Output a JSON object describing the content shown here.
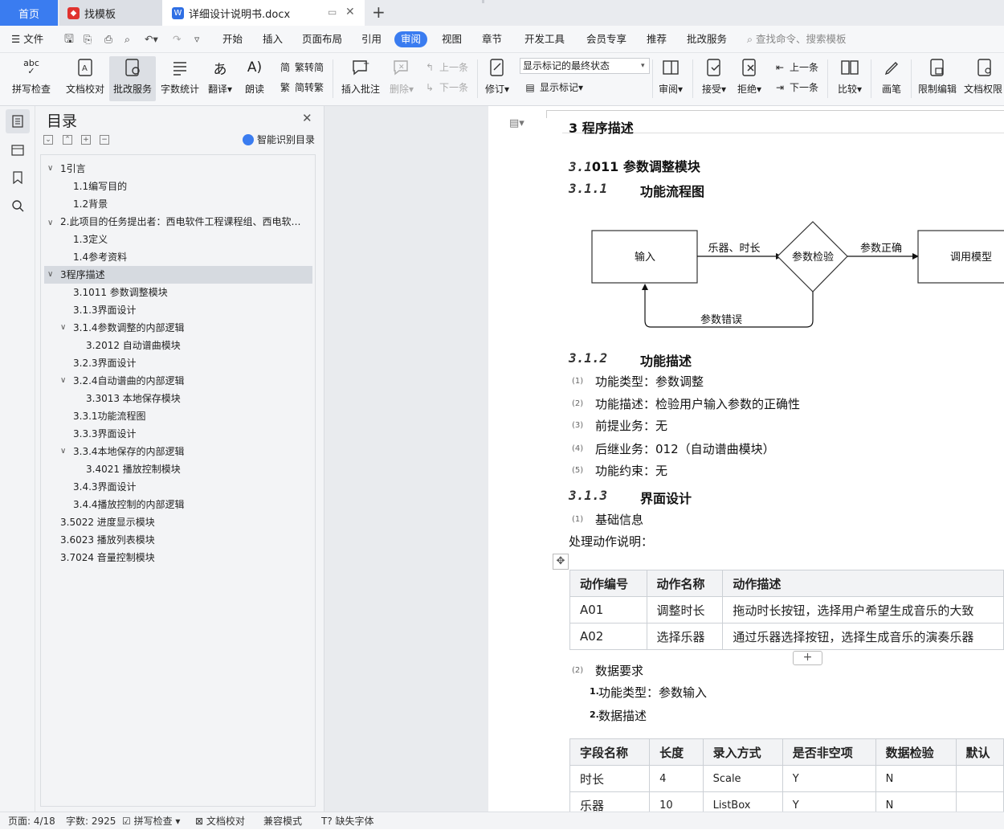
{
  "tabs": {
    "home": "首页",
    "template": "找模板",
    "doc": "详细设计说明书.docx"
  },
  "menu": {
    "file": "文件",
    "items": [
      "开始",
      "插入",
      "页面布局",
      "引用",
      "审阅",
      "视图",
      "章节",
      "开发工具",
      "会员专享",
      "推荐",
      "批改服务"
    ],
    "search": "查找命令、搜索模板"
  },
  "ribbon": {
    "spellcheck": "拼写检查",
    "proofread": "文档校对",
    "correction": "批改服务",
    "wordcount": "字数统计",
    "translate": "翻译",
    "read": "朗读",
    "trad2simp": "繁转简",
    "simp2trad": "简转繁",
    "insert_comment": "插入批注",
    "delete": "删除",
    "prev": "上一条",
    "next": "下一条",
    "revise": "修订",
    "markup_state": "显示标记的最终状态",
    "show_markup": "显示标记",
    "review": "审阅",
    "accept": "接受",
    "reject": "拒绝",
    "prev2": "上一条",
    "next2": "下一条",
    "compare": "比较",
    "pen": "画笔",
    "restrict": "限制编辑",
    "doc_perm": "文档权限"
  },
  "toc": {
    "title": "目录",
    "smart": "智能识别目录",
    "items": [
      "1引言",
      "1.1编写目的",
      "1.2背景",
      "2.此项目的任务提出者：西电软件工程课程组、西电软…",
      "1.3定义",
      "1.4参考资料",
      "3程序描述",
      "3.1011 参数调整模块",
      "3.1.3界面设计",
      "3.1.4参数调整的内部逻辑",
      "3.2012 自动谱曲模块",
      "3.2.3界面设计",
      "3.2.4自动谱曲的内部逻辑",
      "3.3013 本地保存模块",
      "3.3.1功能流程图",
      "3.3.3界面设计",
      "3.3.4本地保存的内部逻辑",
      "3.4021 播放控制模块",
      "3.4.3界面设计",
      "3.4.4播放控制的内部逻辑",
      "3.5022 进度显示模块",
      "3.6023 播放列表模块",
      "3.7024 音量控制模块"
    ]
  },
  "doc": {
    "h_section": "3 程序描述",
    "h_31_num": "3.1",
    "h_31_text": "011 参数调整模块",
    "h_311_num": "3.1.1",
    "h_311_text": "功能流程图",
    "flow": {
      "input": "输入",
      "edge1": "乐器、时长",
      "check": "参数检验",
      "edge2": "参数正确",
      "call": "调用模型",
      "error": "参数错误"
    },
    "h_312_num": "3.1.2",
    "h_312_text": "功能描述",
    "desc_marks": [
      "(1)",
      "(2)",
      "(3)",
      "(4)",
      "(5)"
    ],
    "desc": [
      "功能类型：参数调整",
      "功能描述：检验用户输入参数的正确性",
      "前提业务：无",
      "后继业务：012（自动谱曲模块）",
      "功能约束：无"
    ],
    "h_313_num": "3.1.3",
    "h_313_text": "界面设计",
    "basic_mark": "(1)",
    "basic": "基础信息",
    "action_note": "处理动作说明：",
    "table1_head": [
      "动作编号",
      "动作名称",
      "动作描述"
    ],
    "table1_rows": [
      [
        "A01",
        "调整时长",
        "拖动时长按钮，选择用户希望生成音乐的大致"
      ],
      [
        "A02",
        "选择乐器",
        "通过乐器选择按钮，选择生成音乐的演奏乐器"
      ]
    ],
    "data_mark": "(2)",
    "data_req": "数据要求",
    "sub1_num": "1.",
    "sub1": "功能类型：参数输入",
    "sub2_num": "2.",
    "sub2": "数据描述",
    "table2_head": [
      "字段名称",
      "长度",
      "录入方式",
      "是否非空项",
      "数据检验",
      "默认"
    ],
    "table2_rows": [
      [
        "时长",
        "4",
        "Scale",
        "Y",
        "N",
        ""
      ],
      [
        "乐器",
        "10",
        "ListBox",
        "Y",
        "N",
        ""
      ]
    ]
  },
  "status": {
    "page": "页面: 4/18",
    "words": "字数: 2925",
    "spell": "拼写检查",
    "proof": "文档校对",
    "compat": "兼容模式",
    "font": "缺失字体"
  }
}
